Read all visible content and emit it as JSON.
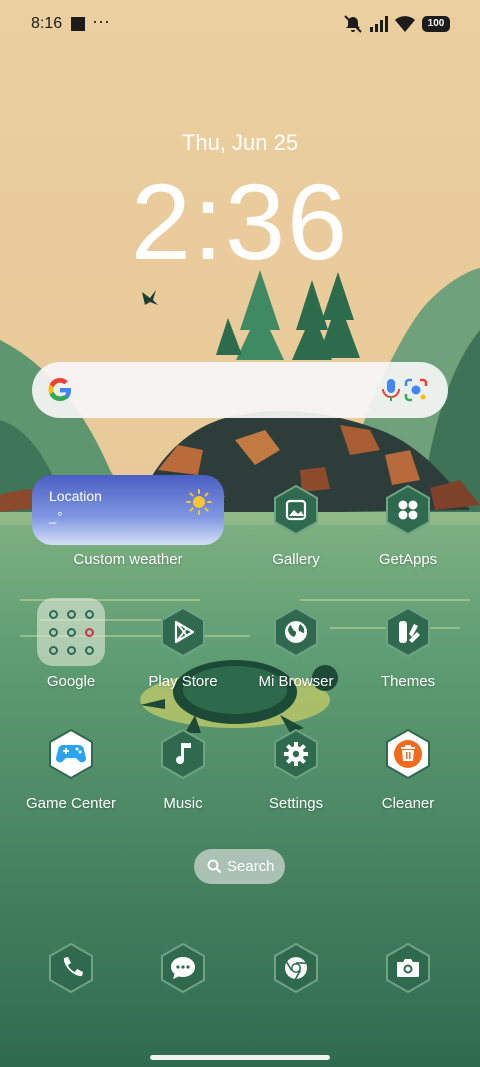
{
  "status_bar": {
    "time": "8:16",
    "dots": "···",
    "battery": "100",
    "icons": [
      "square-icon",
      "more-dots-icon",
      "vibrate-off-icon",
      "signal-icon",
      "wifi-icon",
      "battery-icon"
    ]
  },
  "clock": {
    "date": "Thu, Jun 25",
    "time": "2:36"
  },
  "search_bar": {
    "icons": [
      "google-g-icon",
      "microphone-icon",
      "google-lens-icon"
    ]
  },
  "weather_widget": {
    "location": "Location",
    "temperature": "_°",
    "icon": "sun-icon"
  },
  "apps": [
    {
      "label": "Custom weather",
      "icon": "weather-widget"
    },
    {
      "label": "Gallery",
      "icon": "gallery-icon"
    },
    {
      "label": "GetApps",
      "icon": "getapps-icon"
    },
    {
      "label": "Google",
      "icon": "folder-icon"
    },
    {
      "label": "Play Store",
      "icon": "play-store-icon"
    },
    {
      "label": "Mi Browser",
      "icon": "globe-icon"
    },
    {
      "label": "Themes",
      "icon": "themes-icon"
    },
    {
      "label": "Game Center",
      "icon": "gamepad-icon"
    },
    {
      "label": "Music",
      "icon": "music-note-icon"
    },
    {
      "label": "Settings",
      "icon": "gear-icon"
    },
    {
      "label": "Cleaner",
      "icon": "trash-icon"
    }
  ],
  "search_pill": {
    "label": "Search",
    "icon": "search-icon"
  },
  "dock": [
    {
      "icon": "phone-icon"
    },
    {
      "icon": "messages-icon"
    },
    {
      "icon": "chrome-icon"
    },
    {
      "icon": "camera-icon"
    }
  ],
  "colors": {
    "sky": "#e9c997",
    "lake": "#3f7d5c",
    "hex_icon_bg": "#2f6a4e",
    "weather_widget": "#4a5fc2",
    "cleaner_accent": "#f26a1b",
    "game_accent": "#2aa3f0"
  }
}
